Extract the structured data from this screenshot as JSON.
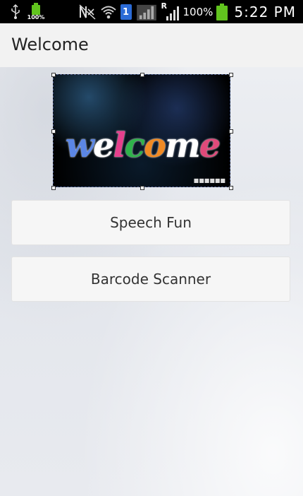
{
  "status_bar": {
    "small_battery_pct": "100%",
    "sim_slot": "1",
    "roaming_indicator": "R",
    "battery_pct": "100%",
    "time": "5:22 PM",
    "icons": [
      "usb-icon",
      "battery-icon",
      "mute-icon",
      "wifi-icon",
      "sim-icon",
      "signal-icon",
      "signal-icon",
      "battery-icon"
    ]
  },
  "app_bar": {
    "title": "Welcome"
  },
  "image": {
    "welcome_letters": [
      "w",
      "e",
      "l",
      "c",
      "o",
      "m",
      "e"
    ],
    "welcome_colors": [
      "#5b86e5",
      "#ffffff",
      "#e63f8c",
      "#2fb34a",
      "#f08a24",
      "#ffffff",
      "#e04a7a"
    ]
  },
  "buttons": {
    "speech_label": "Speech Fun",
    "barcode_label": "Barcode Scanner"
  },
  "colors": {
    "status_bar": "#000000",
    "battery": "#61c41e",
    "sim": "#2b6bd6"
  }
}
